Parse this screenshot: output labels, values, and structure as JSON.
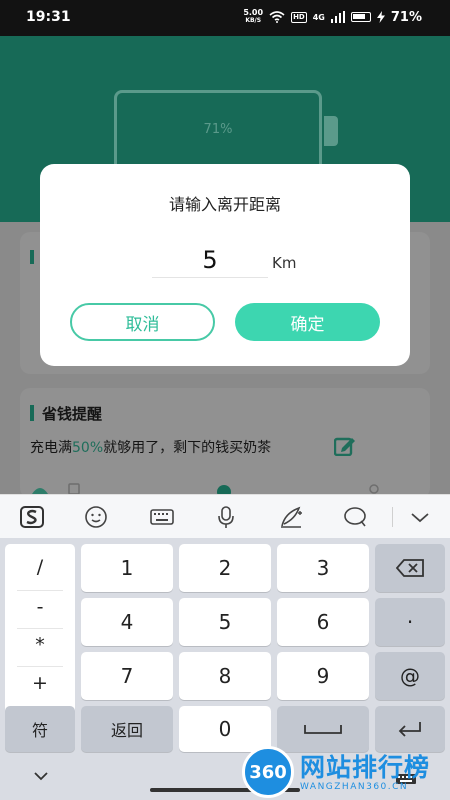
{
  "status_bar": {
    "time": "19:31",
    "net_speed": "5.00",
    "net_unit": "KB/S",
    "hd": "HD",
    "signal": "4G",
    "battery": "71%"
  },
  "app": {
    "battery_percent": "71%",
    "card_title": "省钱提醒",
    "card_text_prefix": "充电满",
    "card_text_highlight": "50%",
    "card_text_suffix": "就够用了，剩下的钱买奶茶"
  },
  "dialog": {
    "title": "请输入离开距离",
    "input_value": "5",
    "unit": "Km",
    "cancel_label": "取消",
    "ok_label": "确定"
  },
  "keyboard": {
    "symbols": [
      "/",
      "-",
      "*",
      "+"
    ],
    "digits": [
      "1",
      "2",
      "3",
      "4",
      "5",
      "6",
      "7",
      "8",
      "9",
      "0"
    ],
    "dot": "·",
    "at": "@",
    "symbol_key": "符",
    "back_key": "返回"
  },
  "watermark": {
    "badge": "360",
    "name": "网站排行榜",
    "url": "WANGZHAN360.CN"
  },
  "colors": {
    "accent": "#3dd6b0",
    "header_green": "#176a57",
    "watermark_blue": "#1e8ee0"
  }
}
